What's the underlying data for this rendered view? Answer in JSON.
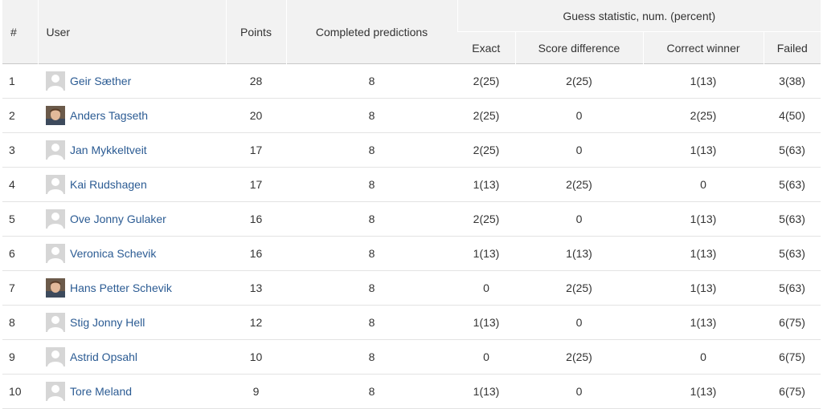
{
  "headers": {
    "rank": "#",
    "user": "User",
    "points": "Points",
    "completed": "Completed predictions",
    "guess_group": "Guess statistic, num. (percent)",
    "exact": "Exact",
    "score_difference": "Score difference",
    "correct_winner": "Correct winner",
    "failed": "Failed"
  },
  "rows": [
    {
      "rank": "1",
      "name": "Geir Sæther",
      "avatar": "default",
      "points": "28",
      "completed": "8",
      "exact": "2(25)",
      "diff": "2(25)",
      "winner": "1(13)",
      "failed": "3(38)"
    },
    {
      "rank": "2",
      "name": "Anders Tagseth",
      "avatar": "photo",
      "points": "20",
      "completed": "8",
      "exact": "2(25)",
      "diff": "0",
      "winner": "2(25)",
      "failed": "4(50)"
    },
    {
      "rank": "3",
      "name": "Jan Mykkeltveit",
      "avatar": "default",
      "points": "17",
      "completed": "8",
      "exact": "2(25)",
      "diff": "0",
      "winner": "1(13)",
      "failed": "5(63)"
    },
    {
      "rank": "4",
      "name": "Kai Rudshagen",
      "avatar": "default",
      "points": "17",
      "completed": "8",
      "exact": "1(13)",
      "diff": "2(25)",
      "winner": "0",
      "failed": "5(63)"
    },
    {
      "rank": "5",
      "name": "Ove Jonny Gulaker",
      "avatar": "default",
      "points": "16",
      "completed": "8",
      "exact": "2(25)",
      "diff": "0",
      "winner": "1(13)",
      "failed": "5(63)"
    },
    {
      "rank": "6",
      "name": "Veronica Schevik",
      "avatar": "default",
      "points": "16",
      "completed": "8",
      "exact": "1(13)",
      "diff": "1(13)",
      "winner": "1(13)",
      "failed": "5(63)"
    },
    {
      "rank": "7",
      "name": "Hans Petter Schevik",
      "avatar": "photo",
      "points": "13",
      "completed": "8",
      "exact": "0",
      "diff": "2(25)",
      "winner": "1(13)",
      "failed": "5(63)"
    },
    {
      "rank": "8",
      "name": "Stig Jonny Hell",
      "avatar": "default",
      "points": "12",
      "completed": "8",
      "exact": "1(13)",
      "diff": "0",
      "winner": "1(13)",
      "failed": "6(75)"
    },
    {
      "rank": "9",
      "name": "Astrid Opsahl",
      "avatar": "default",
      "points": "10",
      "completed": "8",
      "exact": "0",
      "diff": "2(25)",
      "winner": "0",
      "failed": "6(75)"
    },
    {
      "rank": "10",
      "name": "Tore Meland",
      "avatar": "default",
      "points": "9",
      "completed": "8",
      "exact": "1(13)",
      "diff": "0",
      "winner": "1(13)",
      "failed": "6(75)"
    }
  ]
}
